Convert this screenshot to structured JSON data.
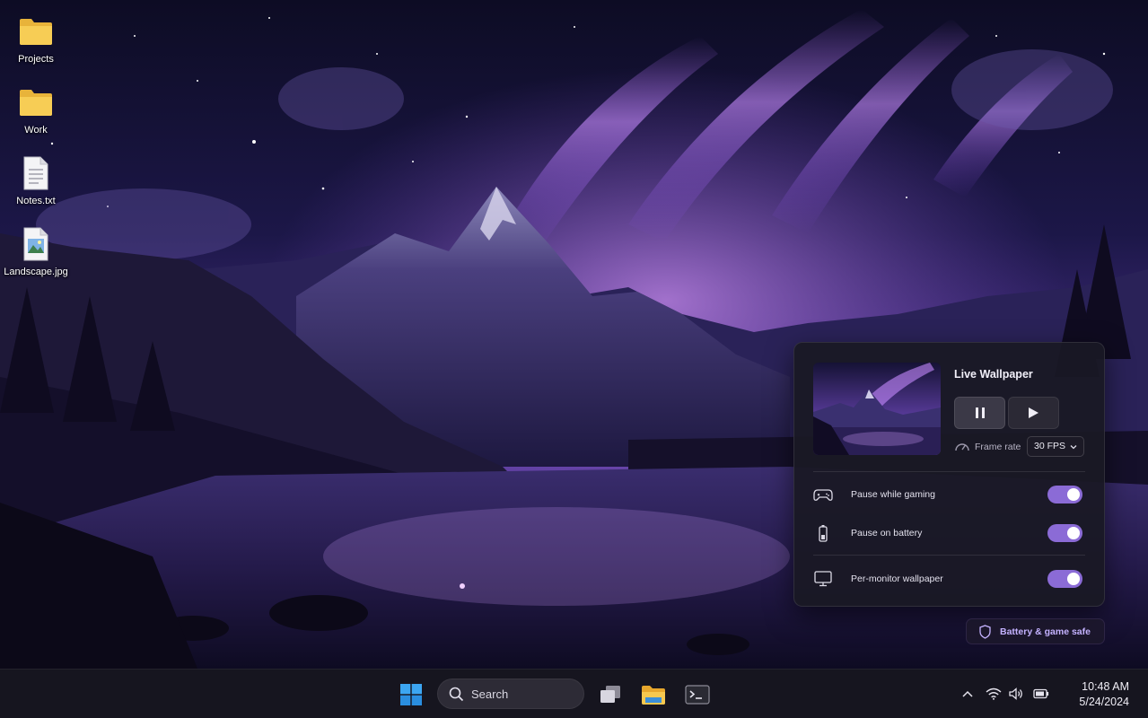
{
  "desktop": {
    "icons": [
      {
        "label": "Projects",
        "icon": "folder-icon"
      },
      {
        "label": "Work",
        "icon": "folder-icon"
      },
      {
        "label": "Notes.txt",
        "icon": "text-file-icon"
      },
      {
        "label": "Landscape.jpg",
        "icon": "image-file-icon"
      }
    ]
  },
  "widget": {
    "title": "Live Wallpaper",
    "pause_icon": "pause-icon",
    "play_icon": "play-icon",
    "frame_rate_label": "Frame rate",
    "frame_rate_value": "30 FPS",
    "settings": [
      {
        "label": "Pause while gaming",
        "icon": "gamepad-icon",
        "enabled": true
      },
      {
        "label": "Pause on battery",
        "icon": "battery-icon",
        "enabled": true
      },
      {
        "label": "Per-monitor wallpaper",
        "icon": "monitor-icon",
        "enabled": true
      }
    ]
  },
  "badge": {
    "label": "Battery & game safe",
    "icon": "shield-icon"
  },
  "taskbar": {
    "search_label": "Search",
    "pinned": [
      "start-icon",
      "task-view-icon",
      "file-explorer-icon",
      "terminal-icon"
    ],
    "tray": [
      "chevron-up-icon",
      "wifi-icon",
      "volume-icon",
      "battery-icon"
    ],
    "time": "10:48 AM",
    "date": "5/24/2024"
  },
  "colors": {
    "accent": "#8b6bd6",
    "badge_text": "#c4b2ff",
    "panel_bg": "#1a1824",
    "taskbar_bg": "#16151f"
  }
}
